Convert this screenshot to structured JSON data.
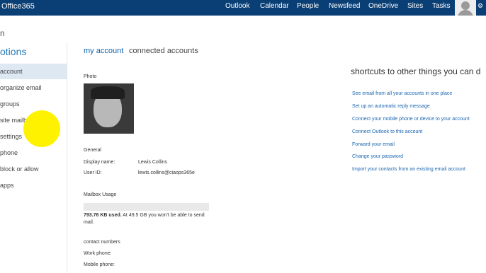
{
  "header": {
    "brand": "Office365",
    "nav": [
      "Outlook",
      "Calendar",
      "People",
      "Newsfeed",
      "OneDrive",
      "Sites",
      "Tasks"
    ]
  },
  "page_title_stub": "n",
  "sidebar": {
    "title": "otions",
    "items": [
      {
        "label": "account",
        "active": true
      },
      {
        "label": "organize email",
        "active": false
      },
      {
        "label": "groups",
        "active": false
      },
      {
        "label": "site mailboxes",
        "active": false
      },
      {
        "label": "settings",
        "active": false
      },
      {
        "label": "phone",
        "active": false
      },
      {
        "label": "block or allow",
        "active": false
      },
      {
        "label": "apps",
        "active": false
      }
    ]
  },
  "tabs": {
    "my_account": "my account",
    "connected_accounts": "connected accounts"
  },
  "photo_label": "Photo",
  "general": {
    "heading": "General",
    "display_name_label": "Display name:",
    "display_name_value": "Lewis Collins",
    "user_id_label": "User ID:",
    "user_id_value": "lewis.collins@ciaops365e"
  },
  "mailbox": {
    "heading": "Mailbox Usage",
    "used": "793.76 KB used.",
    "limit_text": " At 49.5 GB you won't be able to send",
    "limit_text2": "mail.",
    "usage_fraction": 0.0
  },
  "contact": {
    "heading": "contact numbers",
    "work_phone_label": "Work phone:",
    "mobile_phone_label": "Mobile phone:"
  },
  "shortcuts": {
    "title": "shortcuts to other things you can d",
    "links": [
      "See email from all your accounts in one place",
      "Set up an automatic reply message",
      "Connect your mobile phone or device to your account",
      "Connect Outlook to this account",
      "Forward your email",
      "Change your password",
      "Import your contacts from an existing email account"
    ]
  },
  "colors": {
    "header_bg": "#0a3f75",
    "accent": "#0f63ae",
    "sidebar_active": "#dde8f3",
    "cursor_highlight": "#fff200"
  },
  "icons": {
    "settings": "gear-icon",
    "user": "avatar"
  }
}
